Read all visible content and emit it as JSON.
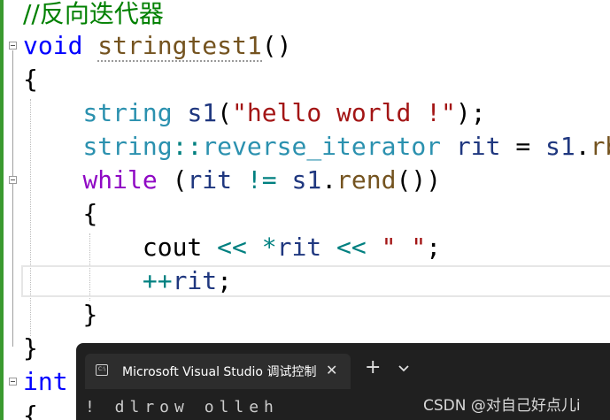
{
  "editor": {
    "comment": "//反向迭代器",
    "func_sig": {
      "kw": "void",
      "name": "stringtest1",
      "parens": "()"
    },
    "open_brace": "{",
    "decl": {
      "type": "string",
      "var": "s1",
      "lp": "(",
      "str": "\"hello world !\"",
      "rp": ");"
    },
    "iter": {
      "type1": "string",
      "scope": "::",
      "type2": "reverse_iterator",
      "var": "rit",
      "eq": " = ",
      "obj": "s1",
      "dot": ".",
      "fn": "rb"
    },
    "while": {
      "kw": "while",
      "lp": " (",
      "var": "rit",
      "op": " != ",
      "obj": "s1",
      "dot": ".",
      "fn": "rend",
      "tail": "())"
    },
    "inner_open": "{",
    "cout": {
      "name": "cout",
      "op1": " << ",
      "star": "*",
      "var": "rit",
      "op2": " << ",
      "str": "\" \"",
      "semi": ";"
    },
    "incr": {
      "op": "++",
      "var": "rit",
      "semi": ";"
    },
    "inner_close": "}",
    "close_brace": "}",
    "next_kw": "int",
    "partial": "{"
  },
  "terminal": {
    "tab_icon": "console-window-icon",
    "tab_title": "Microsoft Visual Studio 调试控制台",
    "close": "✕",
    "new_tab": "+",
    "output": "! dlrow olleh"
  },
  "watermark": "CSDN @对自己好点儿i",
  "colors": {
    "keyword": "#0000ff",
    "type": "#2b91af",
    "string": "#a31515",
    "variable": "#1f377f",
    "control": "#8f08c4",
    "operator": "#008080",
    "function": "#74531f",
    "comment": "#008000",
    "terminal_bg": "#202020",
    "gutter_change": "#3a9a2f"
  }
}
